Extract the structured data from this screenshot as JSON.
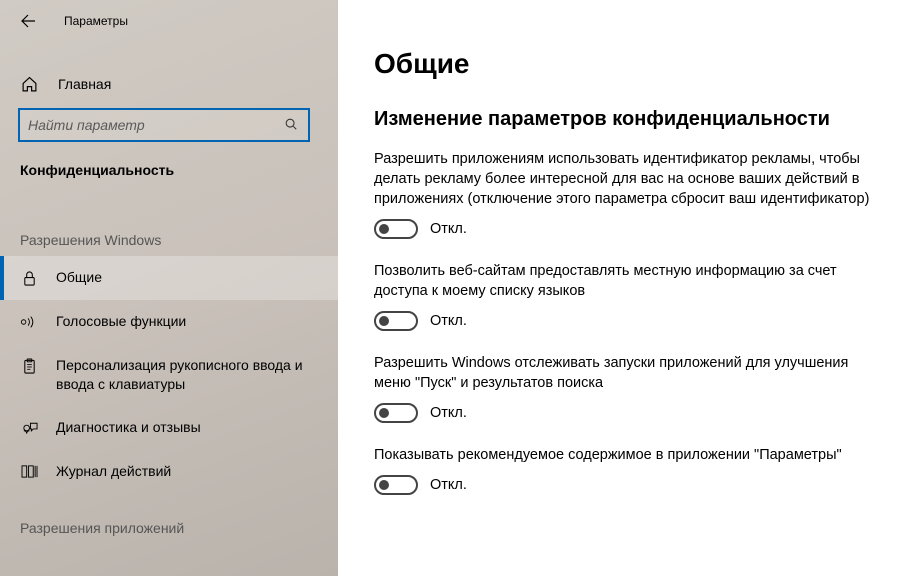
{
  "window": {
    "title": "Параметры"
  },
  "nav": {
    "home": "Главная",
    "search_placeholder": "Найти параметр",
    "category": "Конфиденциальность",
    "group_permissions_windows": "Разрешения Windows",
    "group_permissions_apps": "Разрешения приложений",
    "items": [
      {
        "label": "Общие"
      },
      {
        "label": "Голосовые функции"
      },
      {
        "label": "Персонализация рукописного ввода и ввода с клавиатуры"
      },
      {
        "label": "Диагностика и отзывы"
      },
      {
        "label": "Журнал действий"
      }
    ]
  },
  "main": {
    "title": "Общие",
    "subtitle": "Изменение параметров конфиденциальности",
    "off_label": "Откл.",
    "settings": [
      {
        "desc": "Разрешить приложениям использовать идентификатор рекламы, чтобы делать рекламу более интересной для вас на основе ваших действий в приложениях (отключение этого параметра сбросит ваш идентификатор)"
      },
      {
        "desc": "Позволить веб-сайтам предоставлять местную информацию за счет доступа к моему списку языков"
      },
      {
        "desc": "Разрешить Windows отслеживать запуски приложений для улучшения меню \"Пуск\" и результатов поиска"
      },
      {
        "desc": "Показывать рекомендуемое содержимое в приложении \"Параметры\""
      }
    ]
  }
}
